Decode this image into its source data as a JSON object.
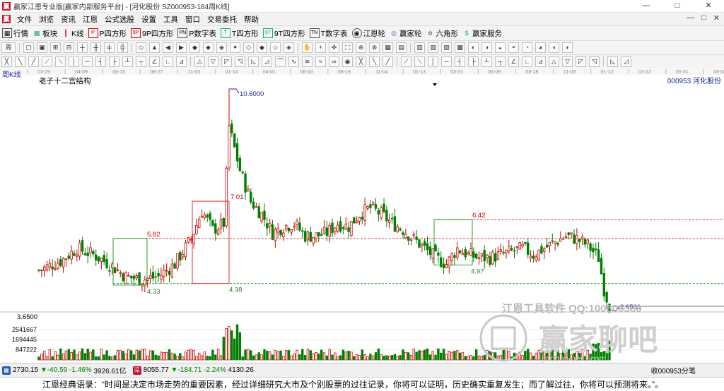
{
  "window": {
    "title": "赢家江恩专业版[赢家内部服务平台] - [河化股份  SZ000953-184周K线]",
    "controls": [
      "—",
      "□",
      "✕"
    ]
  },
  "menu": {
    "items": [
      "文件",
      "浏览",
      "资讯",
      "江恩",
      "公式选股",
      "设置",
      "工具",
      "窗口",
      "交易委托",
      "帮助"
    ],
    "right": [
      "—",
      "□",
      "✕"
    ]
  },
  "toolbar": {
    "items": [
      {
        "label": "行情",
        "icon": "grid-icon"
      },
      {
        "label": "板块",
        "icon": "blocks-icon"
      },
      {
        "label": "K线",
        "icon": "kline-icon"
      },
      {
        "label": "P四方形",
        "icon": "p-square-icon"
      },
      {
        "label": "9P四方形",
        "icon": "9p-square-icon"
      },
      {
        "label": "P数字表",
        "icon": "pn-table-icon"
      },
      {
        "label": "T四方形",
        "icon": "t-square-icon"
      },
      {
        "label": "9T四方形",
        "icon": "9t-square-icon"
      },
      {
        "label": "T数字表",
        "icon": "tn-table-icon"
      },
      {
        "label": "江恩轮",
        "icon": "gann-wheel-icon"
      },
      {
        "label": "赢家轮",
        "icon": "winner-wheel-icon"
      },
      {
        "label": "六角形",
        "icon": "hexagon-icon"
      },
      {
        "label": "赢家服务",
        "icon": "dollar-icon"
      }
    ],
    "row2_period": "周",
    "row2_count": 40,
    "row3_count": 46
  },
  "chart": {
    "panel_label": "周K线",
    "study_name": "老子十二宫结构",
    "stock": "000953  河化股份",
    "date_ticks": [
      "03-29",
      "04-09",
      "06-10",
      "08-27",
      "11-05",
      "01-14",
      "04-01",
      "06-10",
      "08-19",
      "11-04",
      "01-13",
      "03-31",
      "06-09",
      "08-18",
      "11-03",
      "01-12",
      "03-22",
      "05-31",
      "08-08"
    ],
    "price_labels": {
      "high": "10.6000",
      "low": "3.6500",
      "axis_low": "3.6500"
    },
    "levels": [
      "5.82",
      "7.01",
      "6.42",
      "4.33",
      "4.38",
      "4.97"
    ],
    "volume_ticks": [
      "2541667",
      "1694445",
      "847222"
    ],
    "watermark": {
      "line1": "江恩工具软件  QQ:100800360",
      "line2": "赢家聊吧",
      "line3": "jiaoba.yuer3.com"
    },
    "colors": {
      "up": "#cc0000",
      "down": "#008000",
      "level_red": "#e23b3b",
      "level_green": "#2f9e2f",
      "label_blue": "#1a2a9a",
      "box_green": "#2f9e2f",
      "box_red": "#d33"
    }
  },
  "chart_data": {
    "type": "candlestick",
    "title": "老子十二宫结构",
    "values_estimated": true,
    "price_range": [
      3.65,
      10.6
    ],
    "levels": [
      5.82,
      7.01,
      6.42,
      4.33,
      4.38,
      4.97,
      3.65,
      10.6
    ],
    "series": {
      "close_anchor_points": [
        [
          0,
          4.8
        ],
        [
          8,
          5.1
        ],
        [
          14,
          5.5
        ],
        [
          20,
          5.3
        ],
        [
          26,
          5.0
        ],
        [
          32,
          4.6
        ],
        [
          38,
          4.5
        ],
        [
          44,
          4.6
        ],
        [
          50,
          5.0
        ],
        [
          56,
          5.8
        ],
        [
          60,
          6.7
        ],
        [
          64,
          6.1
        ],
        [
          68,
          6.3
        ],
        [
          70,
          9.4
        ],
        [
          74,
          8.0
        ],
        [
          78,
          7.0
        ],
        [
          82,
          6.6
        ],
        [
          86,
          6.0
        ],
        [
          90,
          6.2
        ],
        [
          94,
          6.3
        ],
        [
          98,
          5.9
        ],
        [
          102,
          5.9
        ],
        [
          106,
          6.0
        ],
        [
          110,
          6.3
        ],
        [
          114,
          6.2
        ],
        [
          118,
          6.6
        ],
        [
          122,
          6.8
        ],
        [
          126,
          6.6
        ],
        [
          130,
          6.3
        ],
        [
          134,
          6.1
        ],
        [
          138,
          5.8
        ],
        [
          142,
          5.5
        ],
        [
          146,
          5.2
        ],
        [
          150,
          5.0
        ],
        [
          154,
          5.5
        ],
        [
          158,
          5.3
        ],
        [
          162,
          5.2
        ],
        [
          166,
          5.2
        ],
        [
          170,
          5.3
        ],
        [
          174,
          5.4
        ],
        [
          178,
          5.5
        ],
        [
          182,
          5.3
        ],
        [
          186,
          5.5
        ],
        [
          190,
          5.7
        ],
        [
          194,
          5.9
        ],
        [
          198,
          5.8
        ],
        [
          202,
          5.6
        ],
        [
          206,
          5.2
        ],
        [
          208,
          4.2
        ],
        [
          210,
          3.65
        ]
      ]
    },
    "boxes": [
      {
        "color": "green",
        "label_low": 4.33,
        "label_high": 5.82
      },
      {
        "color": "red",
        "label_low": 4.38,
        "label_high": 7.01
      },
      {
        "color": "green",
        "label_low": 4.97,
        "label_high": 6.42
      }
    ],
    "volume_axis_ticks": [
      2541667,
      1694445,
      847222
    ]
  },
  "status": {
    "sh_index": "2730.15",
    "sh_change": "▼-40.59",
    "sh_pct": "-1.46%",
    "sh_amount": "3926.61亿",
    "sz_index": "8055.77",
    "sz_change": "▼-184.71",
    "sz_pct": "-2.24%",
    "sz_amount": "4130.26",
    "right_text": "收000953分笔"
  },
  "quote": {
    "text": "江恩经典语录：“时间是决定市场走势的重要因素，经过详细研究大市及个别股票的过往记录，你将可以证明，历史确实重复发生；而了解过往，你将可以预测将来。”。"
  }
}
